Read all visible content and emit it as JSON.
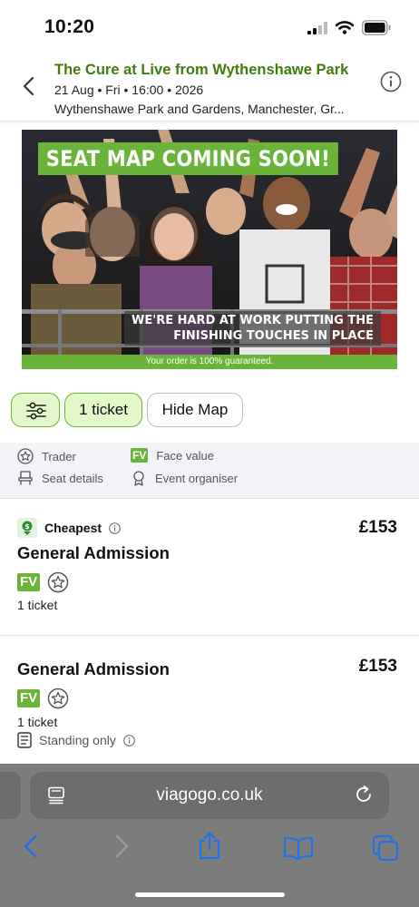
{
  "status_bar": {
    "time": "10:20"
  },
  "event": {
    "title": "The Cure at Live from Wythenshawe Park",
    "datetime": "21 Aug • Fri • 16:00 • 2026",
    "venue": "Wythenshawe Park and Gardens, Manchester, Gr..."
  },
  "banner": {
    "title": "SEAT MAP COMING SOON!",
    "subtitle_line1": "WE'RE HARD AT WORK PUTTING THE",
    "subtitle_line2": "FINISHING TOUCHES IN PLACE",
    "footer": "Your order is 100% guaranteed."
  },
  "controls": {
    "ticket_label": "1 ticket",
    "hide_map_label": "Hide Map"
  },
  "legend": {
    "trader": "Trader",
    "face_value": "Face value",
    "seat_details": "Seat details",
    "event_organiser": "Event organiser",
    "fv_badge": "FV"
  },
  "listings": [
    {
      "tag": "Cheapest",
      "price": "£153",
      "title": "General Admission",
      "badge": "FV",
      "tickets": "1 ticket"
    },
    {
      "price": "£153",
      "title": "General Admission",
      "badge": "FV",
      "tickets": "1 ticket",
      "note": "Standing only"
    }
  ],
  "browser": {
    "url": "viagogo.co.uk"
  },
  "colors": {
    "brand_green": "#6bb43a",
    "title_green": "#3f7d0e",
    "chip_bg": "#e3f7c8"
  }
}
